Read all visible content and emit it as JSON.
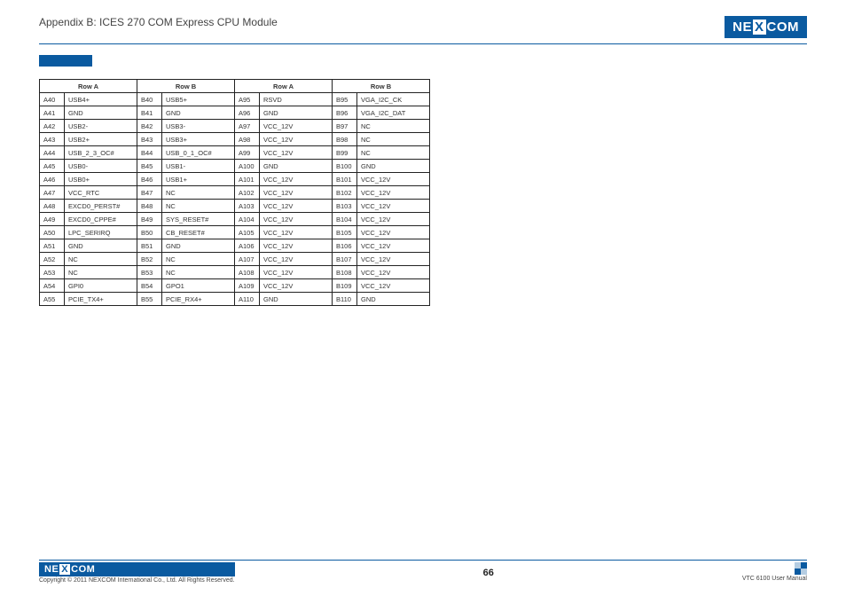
{
  "header": {
    "title": "Appendix B: ICES 270 COM Express CPU Module",
    "logo_pre": "NE",
    "logo_x": "X",
    "logo_post": "COM"
  },
  "table": {
    "headers": [
      "Row A",
      "Row B",
      "Row A",
      "Row B"
    ],
    "rows": [
      [
        "A40",
        "USB4+",
        "B40",
        "USB5+",
        "A95",
        "RSVD",
        "B95",
        "VGA_I2C_CK"
      ],
      [
        "A41",
        "GND",
        "B41",
        "GND",
        "A96",
        "GND",
        "B96",
        "VGA_I2C_DAT"
      ],
      [
        "A42",
        "USB2-",
        "B42",
        "USB3-",
        "A97",
        "VCC_12V",
        "B97",
        "NC"
      ],
      [
        "A43",
        "USB2+",
        "B43",
        "USB3+",
        "A98",
        "VCC_12V",
        "B98",
        "NC"
      ],
      [
        "A44",
        "USB_2_3_OC#",
        "B44",
        "USB_0_1_OC#",
        "A99",
        "VCC_12V",
        "B99",
        "NC"
      ],
      [
        "A45",
        "USB0-",
        "B45",
        "USB1-",
        "A100",
        "GND",
        "B100",
        "GND"
      ],
      [
        "A46",
        "USB0+",
        "B46",
        "USB1+",
        "A101",
        "VCC_12V",
        "B101",
        "VCC_12V"
      ],
      [
        "A47",
        "VCC_RTC",
        "B47",
        "NC",
        "A102",
        "VCC_12V",
        "B102",
        "VCC_12V"
      ],
      [
        "A48",
        "EXCD0_PERST#",
        "B48",
        "NC",
        "A103",
        "VCC_12V",
        "B103",
        "VCC_12V"
      ],
      [
        "A49",
        "EXCD0_CPPE#",
        "B49",
        "SYS_RESET#",
        "A104",
        "VCC_12V",
        "B104",
        "VCC_12V"
      ],
      [
        "A50",
        "LPC_SERIRQ",
        "B50",
        "CB_RESET#",
        "A105",
        "VCC_12V",
        "B105",
        "VCC_12V"
      ],
      [
        "A51",
        "GND",
        "B51",
        "GND",
        "A106",
        "VCC_12V",
        "B106",
        "VCC_12V"
      ],
      [
        "A52",
        "NC",
        "B52",
        "NC",
        "A107",
        "VCC_12V",
        "B107",
        "VCC_12V"
      ],
      [
        "A53",
        "NC",
        "B53",
        "NC",
        "A108",
        "VCC_12V",
        "B108",
        "VCC_12V"
      ],
      [
        "A54",
        "GPI0",
        "B54",
        "GPO1",
        "A109",
        "VCC_12V",
        "B109",
        "VCC_12V"
      ],
      [
        "A55",
        "PCIE_TX4+",
        "B55",
        "PCIE_RX4+",
        "A110",
        "GND",
        "B110",
        "GND"
      ]
    ]
  },
  "footer": {
    "copyright": "Copyright © 2011 NEXCOM International Co., Ltd. All Rights Reserved.",
    "page": "66",
    "manual": "VTC 6100 User Manual"
  }
}
